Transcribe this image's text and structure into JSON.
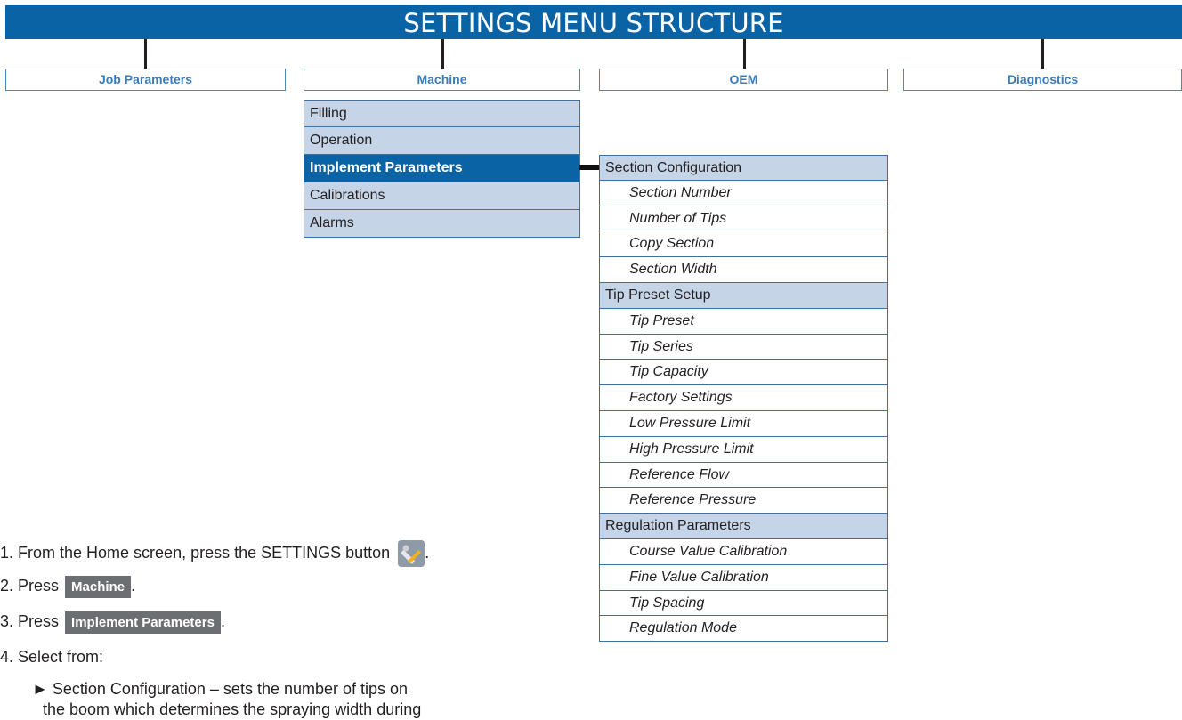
{
  "header": {
    "title": "SETTINGS MENU STRUCTURE"
  },
  "categories": [
    "Job Parameters",
    "Machine",
    "OEM",
    "Diagnostics"
  ],
  "machine_menu": [
    "Filling",
    "Operation",
    "Implement Parameters",
    "Calibrations",
    "Alarms"
  ],
  "submenu": [
    {
      "label": "Section Configuration",
      "kind": "head"
    },
    {
      "label": "Section Number",
      "kind": "leaf"
    },
    {
      "label": "Number of Tips",
      "kind": "leaf"
    },
    {
      "label": "Copy Section",
      "kind": "leaf"
    },
    {
      "label": "Section Width",
      "kind": "leaf"
    },
    {
      "label": "Tip Preset Setup",
      "kind": "head"
    },
    {
      "label": "Tip Preset",
      "kind": "leaf"
    },
    {
      "label": "Tip Series",
      "kind": "leaf"
    },
    {
      "label": "Tip Capacity",
      "kind": "leaf"
    },
    {
      "label": "Factory Settings",
      "kind": "leaf"
    },
    {
      "label": "Low Pressure Limit",
      "kind": "leaf"
    },
    {
      "label": "High Pressure Limit",
      "kind": "leaf"
    },
    {
      "label": "Reference Flow",
      "kind": "leaf"
    },
    {
      "label": "Reference Pressure",
      "kind": "leaf"
    },
    {
      "label": "Regulation Parameters",
      "kind": "head"
    },
    {
      "label": "Course Value Calibration",
      "kind": "leaf"
    },
    {
      "label": "Fine Value Calibration",
      "kind": "leaf"
    },
    {
      "label": "Tip Spacing",
      "kind": "leaf"
    },
    {
      "label": "Regulation Mode",
      "kind": "leaf"
    }
  ],
  "steps": {
    "s1": "1. From the Home screen, press the SETTINGS button",
    "s2_prefix": "2. Press",
    "s2_button": "Machine",
    "s3_prefix": "3. Press",
    "s3_button": "Implement Parameters",
    "s4": "4. Select from:",
    "bullet": "► Section Configuration – sets the number of tips on",
    "bullet_cont": "the boom which determines the spraying width during",
    "period": "."
  },
  "icons": {
    "settings": "settings-wrench-screwdriver-icon"
  },
  "colors": {
    "accent": "#0a63a5",
    "menu_bg": "#c5d4e7",
    "button_gray": "#6d6e71"
  }
}
